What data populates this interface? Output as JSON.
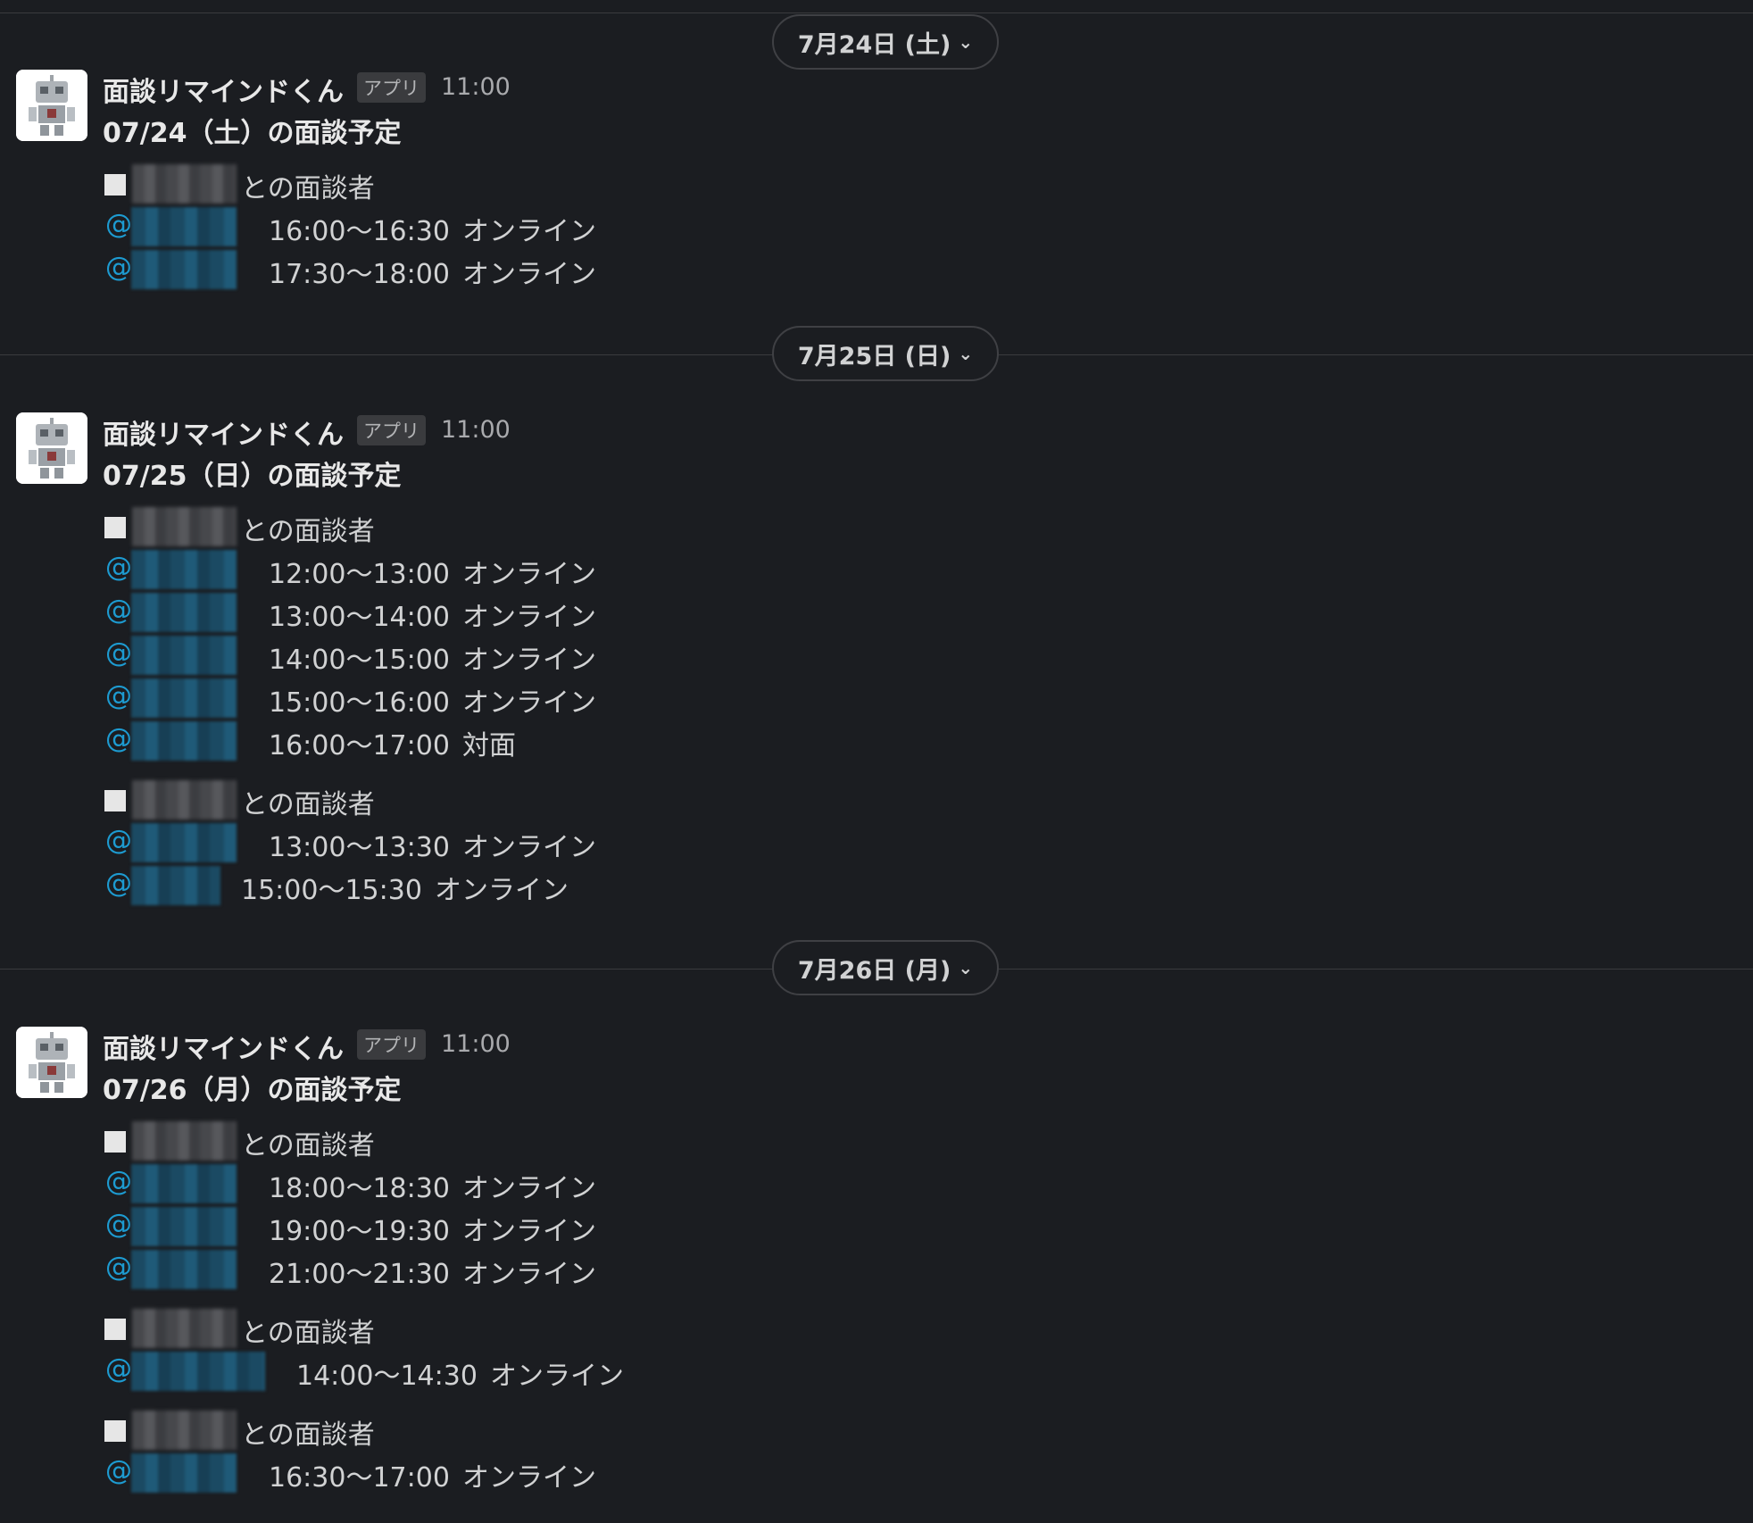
{
  "bot": {
    "name": "面談リマインドくん",
    "badge": "アプリ",
    "time": "11:00"
  },
  "dividers": [
    {
      "label": "7月24日 (土)",
      "chevron": "chevron-down-icon"
    },
    {
      "label": "7月25日 (日)",
      "chevron": "chevron-down-icon"
    },
    {
      "label": "7月26日 (月)",
      "chevron": "chevron-down-icon"
    }
  ],
  "messages": [
    {
      "subject": "07/24（土）の面談予定",
      "groups": [
        {
          "host_suffix": "との面談者",
          "rows": [
            {
              "at": "@",
              "slot": "16:00〜16:30",
              "place": "オンライン"
            },
            {
              "at": "@",
              "slot": "17:30〜18:00",
              "place": "オンライン"
            }
          ]
        }
      ]
    },
    {
      "subject": "07/25（日）の面談予定",
      "groups": [
        {
          "host_suffix": "との面談者",
          "rows": [
            {
              "at": "@",
              "slot": "12:00〜13:00",
              "place": "オンライン"
            },
            {
              "at": "@",
              "slot": "13:00〜14:00",
              "place": "オンライン"
            },
            {
              "at": "@",
              "slot": "14:00〜15:00",
              "place": "オンライン"
            },
            {
              "at": "@",
              "slot": "15:00〜16:00",
              "place": "オンライン"
            },
            {
              "at": "@",
              "slot": "16:00〜17:00",
              "place": "対面"
            }
          ]
        },
        {
          "host_suffix": "との面談者",
          "rows": [
            {
              "at": "@",
              "slot": "13:00〜13:30",
              "place": "オンライン"
            },
            {
              "at": "@",
              "slot": "15:00〜15:30",
              "place": "オンライン"
            }
          ]
        }
      ]
    },
    {
      "subject": "07/26（月）の面談予定",
      "groups": [
        {
          "host_suffix": "との面談者",
          "rows": [
            {
              "at": "@",
              "slot": "18:00〜18:30",
              "place": "オンライン"
            },
            {
              "at": "@",
              "slot": "19:00〜19:30",
              "place": "オンライン"
            },
            {
              "at": "@",
              "slot": "21:00〜21:30",
              "place": "オンライン"
            }
          ]
        },
        {
          "host_suffix": "との面談者",
          "rows": [
            {
              "at": "@",
              "slot": "14:00〜14:30",
              "place": "オンライン"
            }
          ]
        },
        {
          "host_suffix": "との面談者",
          "rows": [
            {
              "at": "@",
              "slot": "16:30〜17:00",
              "place": "オンライン"
            }
          ]
        }
      ]
    }
  ],
  "colors": {
    "background": "#1b1d21",
    "mention": "#1d9bd1",
    "text": "#d1d2d3"
  }
}
